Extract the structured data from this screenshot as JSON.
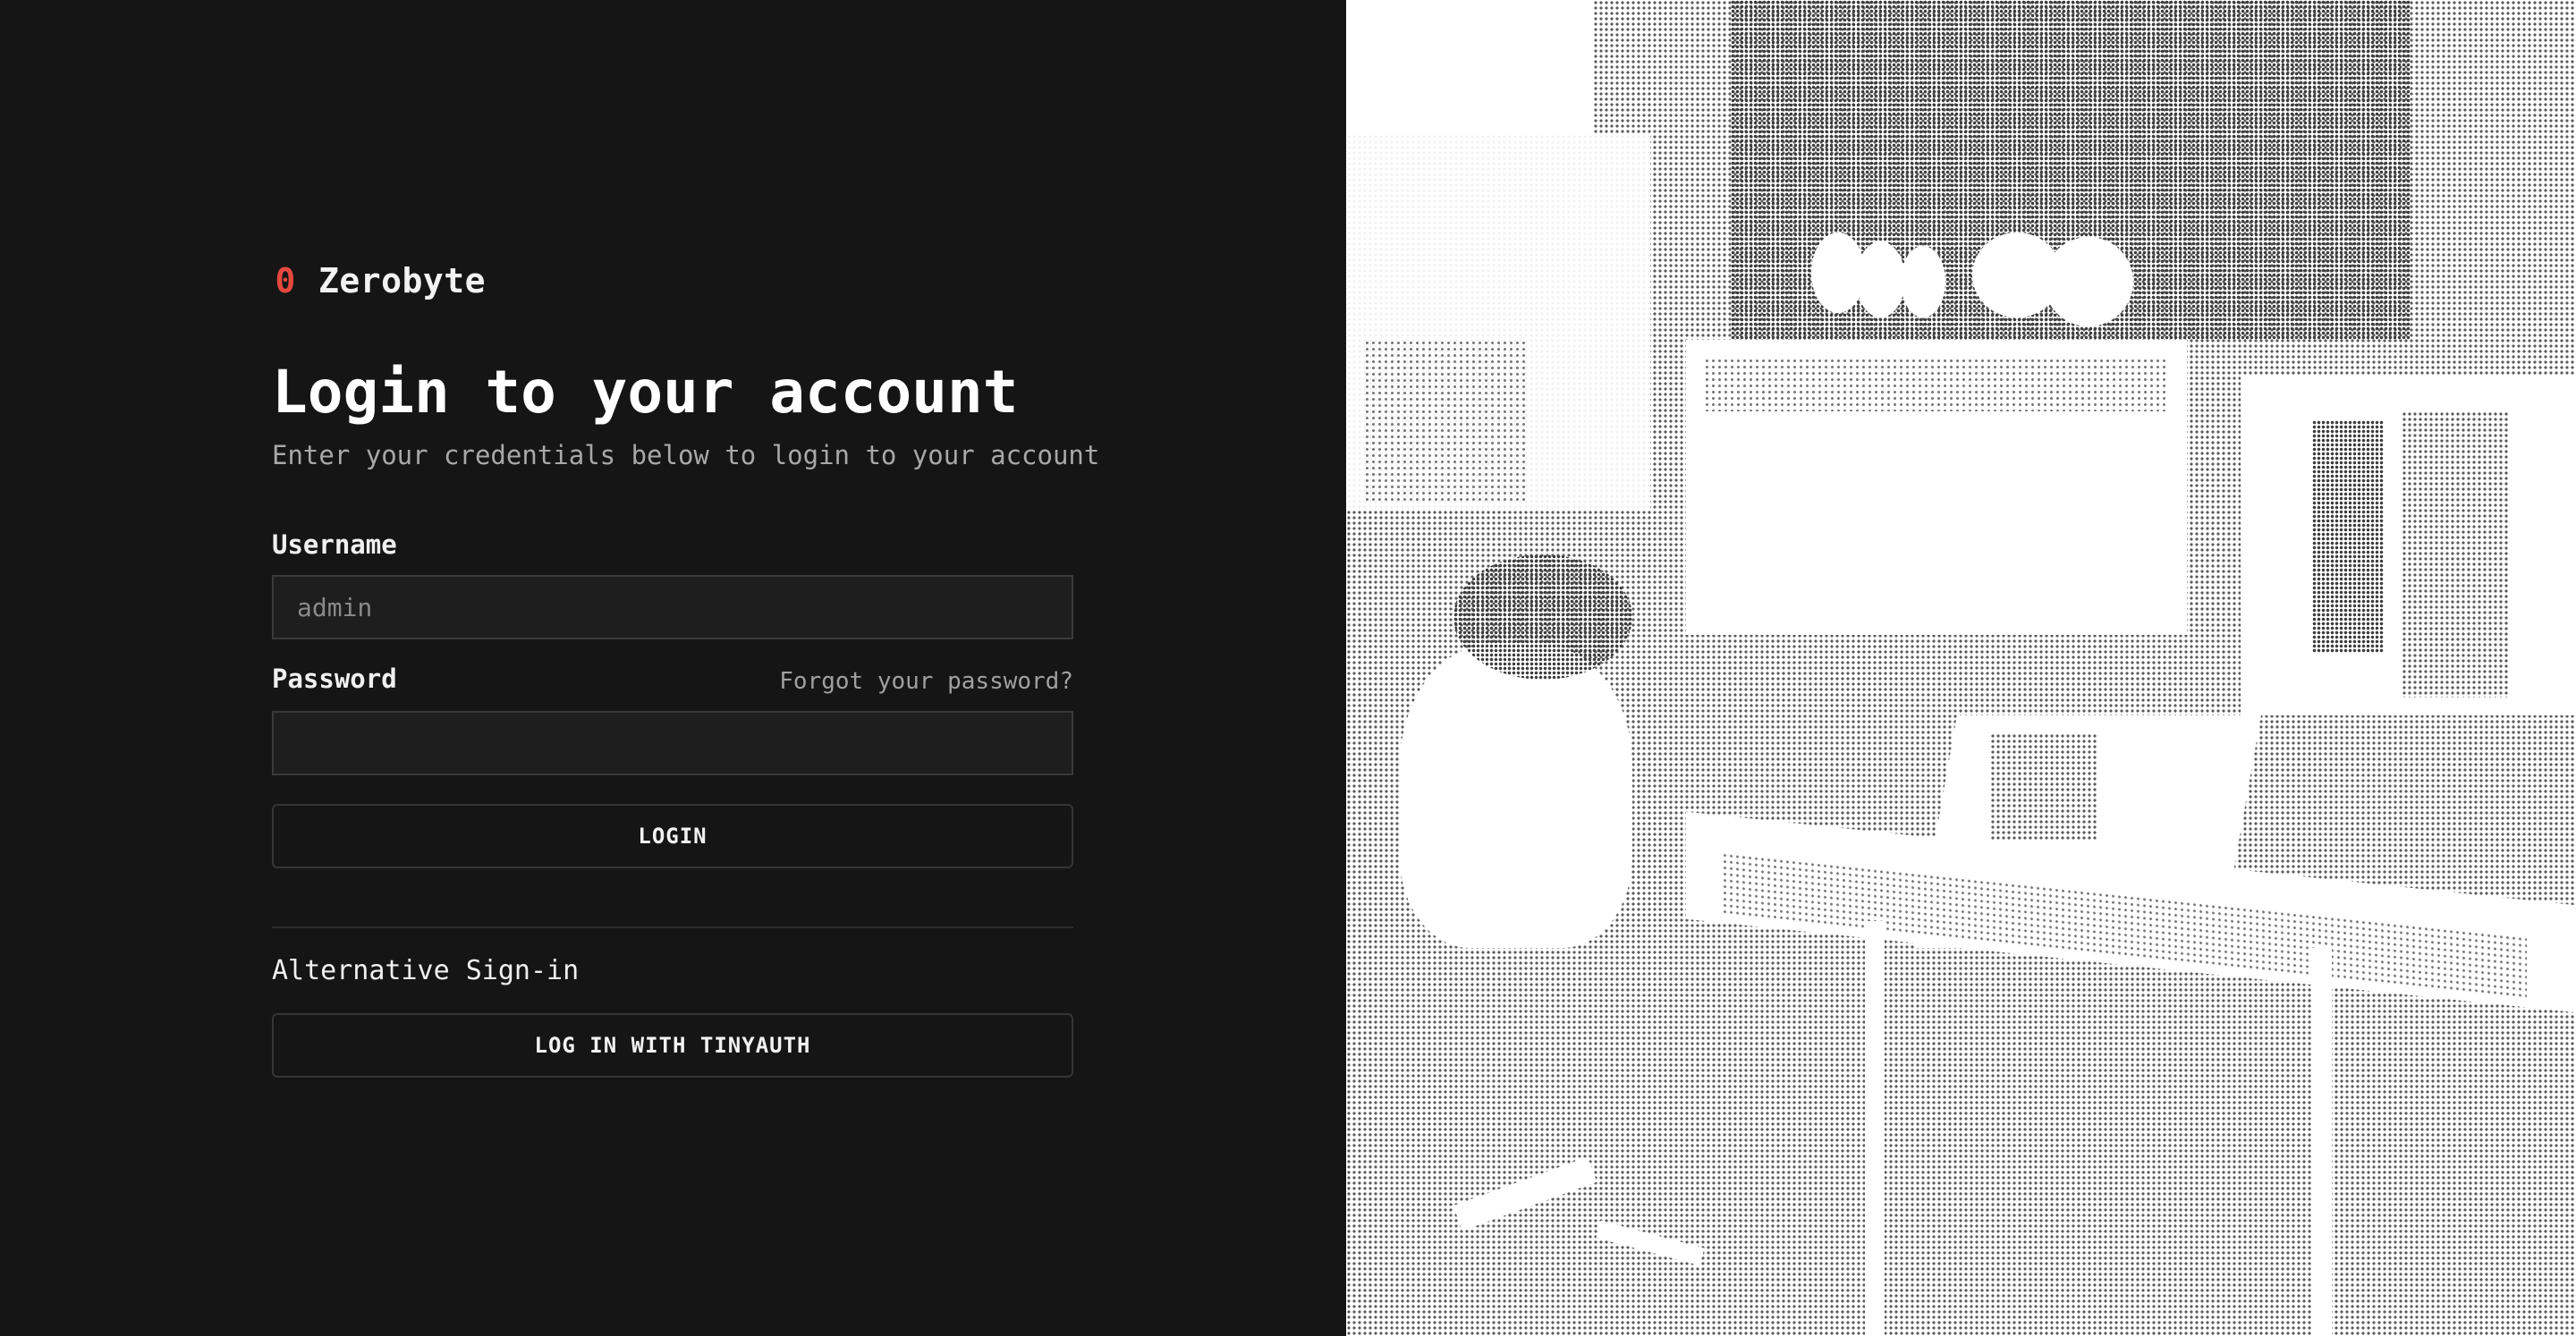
{
  "brand": {
    "icon": "0",
    "name": "Zerobyte",
    "accent_color": "#e5483d"
  },
  "login": {
    "title": "Login to your account",
    "subtitle": "Enter your credentials below to login to your account",
    "username_label": "Username",
    "username_placeholder": "admin",
    "username_value": "",
    "password_label": "Password",
    "password_value": "",
    "forgot_password": "Forgot your password?",
    "login_button": "LOGIN"
  },
  "alternative": {
    "label": "Alternative Sign-in",
    "tinyauth_button": "LOG IN WITH TINYAUTH"
  },
  "hero_image": {
    "icon": "halftone-photo-computer-room"
  }
}
